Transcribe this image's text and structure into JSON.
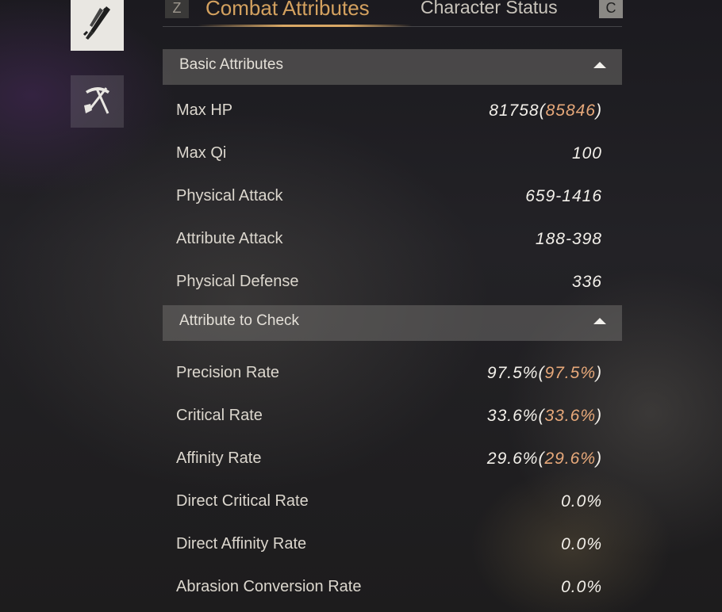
{
  "sidebar": {
    "icons": [
      {
        "name": "sword-scabbard-icon",
        "active": true
      },
      {
        "name": "pickaxe-shovel-icon",
        "active": false
      }
    ]
  },
  "tabs": {
    "prev_key": "Z",
    "next_key": "C",
    "items": [
      {
        "label": "Combat Attributes",
        "active": true
      },
      {
        "label": "Character Status",
        "active": false
      }
    ]
  },
  "colors": {
    "accent": "#d4a15f",
    "bonus_value": "#e8a97a"
  },
  "sections": [
    {
      "title": "Basic Attributes",
      "expanded": true,
      "rows": [
        {
          "label": "Max HP",
          "value": "81758",
          "paren_open": "(",
          "bonus": "85846",
          "paren_close": ")"
        },
        {
          "label": "Max Qi",
          "value": "100"
        },
        {
          "label": "Physical Attack",
          "value": "659-1416"
        },
        {
          "label": "Attribute Attack",
          "value": "188-398"
        },
        {
          "label": "Physical Defense",
          "value": "336"
        }
      ]
    },
    {
      "title": "Attribute to Check",
      "expanded": true,
      "rows": [
        {
          "label": "Precision Rate",
          "value": "97.5%",
          "paren_open": "(",
          "bonus": "97.5%",
          "paren_close": ")"
        },
        {
          "label": "Critical Rate",
          "value": "33.6%",
          "paren_open": "(",
          "bonus": "33.6%",
          "paren_close": ")"
        },
        {
          "label": "Affinity Rate",
          "value": "29.6%",
          "paren_open": "(",
          "bonus": "29.6%",
          "paren_close": ")"
        },
        {
          "label": "Direct Critical Rate",
          "value_orange": "0.0%"
        },
        {
          "label": "Direct Affinity Rate",
          "value_orange": "0.0%"
        },
        {
          "label": "Abrasion Conversion Rate",
          "value": "0.0%"
        }
      ]
    }
  ]
}
